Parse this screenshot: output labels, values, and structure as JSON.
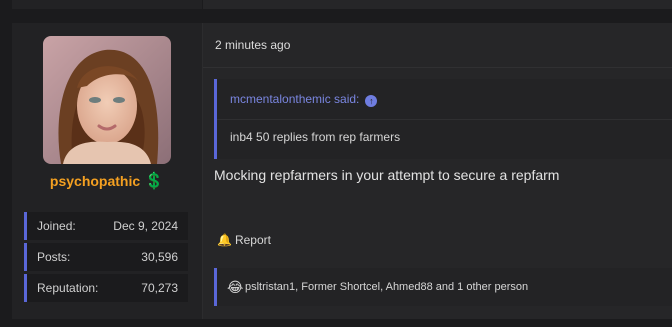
{
  "post": {
    "author": {
      "username": "psychopathic",
      "badge_icon": "money-bag-icon",
      "username_color": "#f4a021",
      "stats": [
        {
          "label": "Joined:",
          "value": "Dec 9, 2024"
        },
        {
          "label": "Posts:",
          "value": "30,596"
        },
        {
          "label": "Reputation:",
          "value": "70,273"
        }
      ]
    },
    "timestamp": "2 minutes ago",
    "quote": {
      "author_text": "mcmentalonthemic said:",
      "body": "inb4 50 replies from rep farmers"
    },
    "message": "Mocking repfarmers in your attempt to secure a repfarm",
    "actions": {
      "report_label": "Report"
    },
    "reactions": {
      "icon": "laughing-emoji-icon",
      "text": "psltristan1, Former Shortcel, Ahmed88 and 1 other person"
    }
  },
  "colors": {
    "accent": "#5a67d8",
    "background": "#1b1b1d"
  }
}
